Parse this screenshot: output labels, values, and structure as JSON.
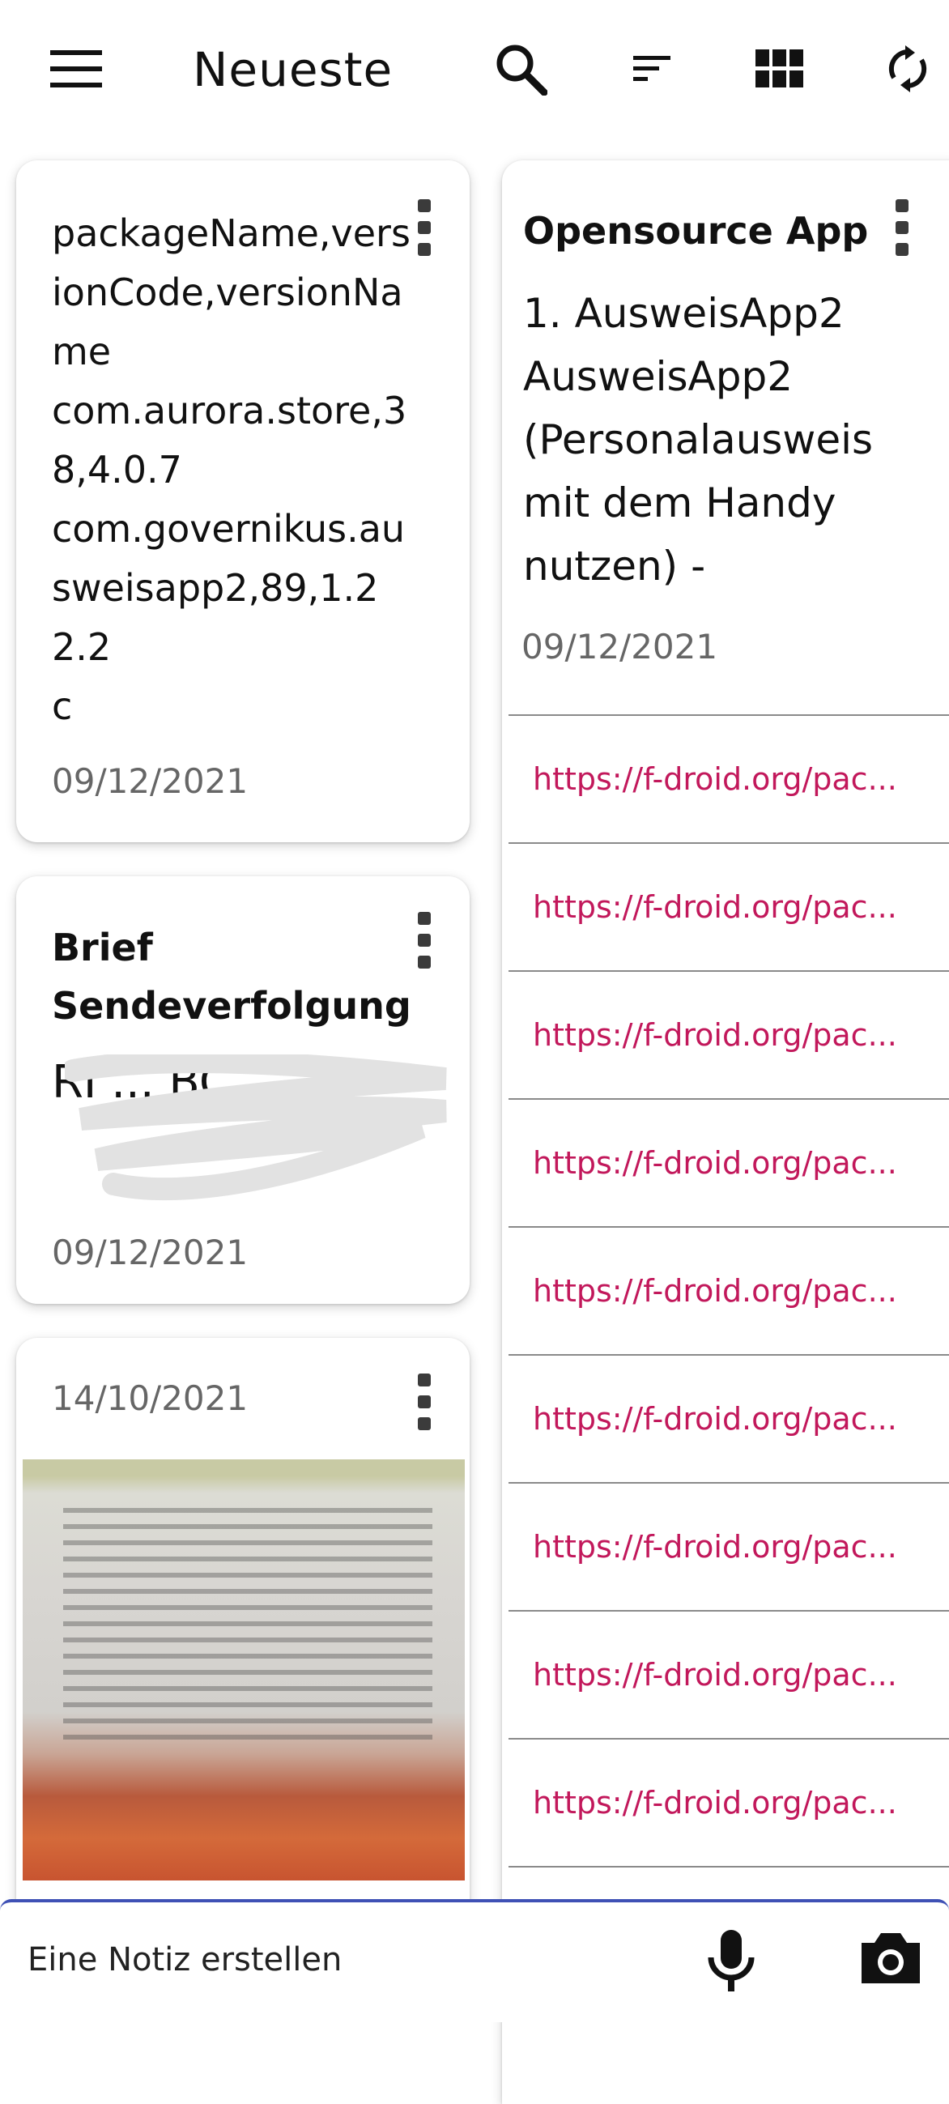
{
  "header": {
    "title": "Neueste",
    "icons": [
      "menu-icon",
      "search-icon",
      "sort-icon",
      "grid-view-icon",
      "sync-icon"
    ]
  },
  "notes_left": [
    {
      "text": "packageName,versionCode,versionName\ncom.aurora.store,38,4.0.7\ncom.governikus.ausweisapp2,89,1.22.2\nc",
      "date": "09/12/2021"
    },
    {
      "title": "Brief Sendeverfolgung",
      "text": "RI ... BC",
      "date": "09/12/2021"
    },
    {
      "date": "14/10/2021",
      "image": "photo-of-printed-recipe"
    }
  ],
  "note_right": {
    "title": "Opensource App",
    "text": "1. AusweisApp2 AusweisApp2 (Personalausweis mit dem Handy nutzen) -",
    "date": "09/12/2021",
    "links": [
      "https://f-droid.org/pac...",
      "https://f-droid.org/pac...",
      "https://f-droid.org/pac...",
      "https://f-droid.org/pac...",
      "https://f-droid.org/pac...",
      "https://f-droid.org/pac...",
      "https://f-droid.org/pac...",
      "https://f-droid.org/pac...",
      "https://f-droid.org/pac..."
    ]
  },
  "bottom_bar": {
    "placeholder": "Eine Notiz erstellen",
    "icons": [
      "microphone-icon",
      "camera-icon"
    ]
  },
  "colors": {
    "link": "#c2185b",
    "accent_bar": "#3f51b5"
  }
}
